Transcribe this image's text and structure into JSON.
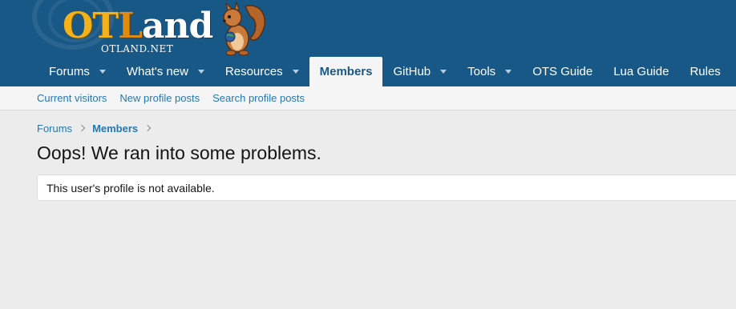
{
  "header": {
    "logo": {
      "word_ot": "OT",
      "word_l": "L",
      "word_and": "and",
      "subtitle": "OTLAND.NET",
      "mascot": "squirrel-mascot"
    },
    "colors": {
      "header_bg": "#185886",
      "link": "#2577b1",
      "page_bg": "#ececec"
    }
  },
  "nav": {
    "tabs": [
      {
        "label": "Forums",
        "has_dropdown": true
      },
      {
        "label": "What's new",
        "has_dropdown": true
      },
      {
        "label": "Resources",
        "has_dropdown": true
      },
      {
        "label": "Members",
        "has_dropdown": false,
        "active": true
      },
      {
        "label": "GitHub",
        "has_dropdown": true
      },
      {
        "label": "Tools",
        "has_dropdown": true
      },
      {
        "label": "OTS Guide",
        "has_dropdown": false
      },
      {
        "label": "Lua Guide",
        "has_dropdown": false
      },
      {
        "label": "Rules",
        "has_dropdown": false
      }
    ]
  },
  "subnav": {
    "links": [
      "Current visitors",
      "New profile posts",
      "Search profile posts"
    ]
  },
  "breadcrumb": {
    "items": [
      "Forums",
      "Members"
    ]
  },
  "main": {
    "title": "Oops! We ran into some problems.",
    "message": "This user's profile is not available."
  }
}
